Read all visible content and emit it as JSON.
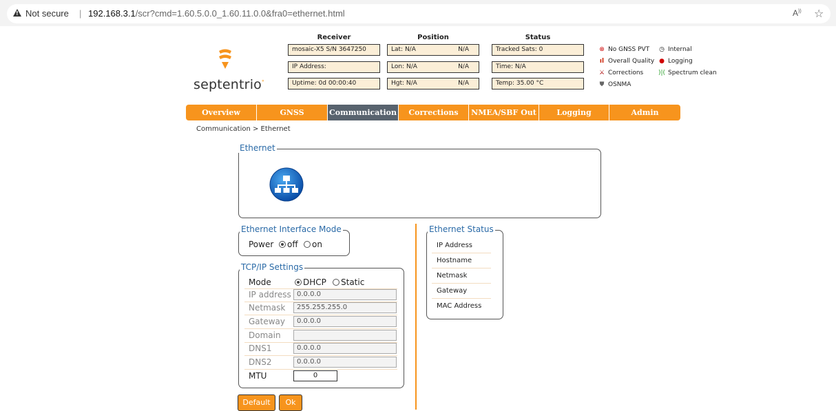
{
  "browser": {
    "security_label": "Not secure",
    "url_host": "192.168.3.1",
    "url_path": "/scr?cmd=1.60.5.0.0_1.60.11.0.0&fra0=ethernet.html",
    "read_aloud": "A",
    "read_aloud_sup": "))"
  },
  "logo": {
    "text": "septentrio",
    "mark": "°"
  },
  "header": {
    "receiver_title": "Receiver",
    "position_title": "Position",
    "status_title": "Status",
    "receiver": [
      "mosaic-X5 S/N 3647250",
      "IP Address:",
      "Uptime: 0d 00:00:40"
    ],
    "position": [
      {
        "label": "Lat: N/A",
        "value": "N/A"
      },
      {
        "label": "Lon: N/A",
        "value": "N/A"
      },
      {
        "label": "Hgt: N/A",
        "value": "N/A"
      }
    ],
    "status": [
      "Tracked Sats: 0",
      "Time: N/A",
      "Temp: 35.00 °C"
    ]
  },
  "legend": {
    "no_pvt": "No GNSS PVT",
    "internal": "Internal",
    "overall_quality": "Overall Quality",
    "logging": "Logging",
    "corrections": "Corrections",
    "spectrum": "Spectrum clean",
    "osnma": "OSNMA",
    "icons": {
      "no_pvt": "x-circle-icon",
      "internal": "clock-icon",
      "overall_quality": "signal-bars-icon",
      "logging": "red-dot-icon",
      "corrections": "antenna-icon",
      "spectrum": "spectrum-icon",
      "osnma": "shield-icon"
    },
    "colors": {
      "logging": "#d00000",
      "spectrum": "#2aa02a",
      "quality": "#cc2200"
    }
  },
  "nav": {
    "tabs": [
      "Overview",
      "GNSS",
      "Communication",
      "Corrections",
      "NMEA/SBF Out",
      "Logging",
      "Admin"
    ],
    "active": "Communication",
    "colors": {
      "bar": "#f7941d",
      "active": "#58636e"
    }
  },
  "breadcrumb": "Communication > Ethernet",
  "ethernet": {
    "legend": "Ethernet",
    "icon": "network-icon"
  },
  "interface_mode": {
    "legend": "Ethernet Interface Mode",
    "power_label": "Power",
    "off_label": "off",
    "on_label": "on",
    "selected": "off"
  },
  "tcpip": {
    "legend": "TCP/IP Settings",
    "mode_label": "Mode",
    "dhcp_label": "DHCP",
    "static_label": "Static",
    "selected": "DHCP",
    "fields": [
      {
        "label": "IP address",
        "value": "0.0.0.0"
      },
      {
        "label": "Netmask",
        "value": "255.255.255.0"
      },
      {
        "label": "Gateway",
        "value": "0.0.0.0"
      },
      {
        "label": "Domain",
        "value": ""
      },
      {
        "label": "DNS1",
        "value": "0.0.0.0"
      },
      {
        "label": "DNS2",
        "value": "0.0.0.0"
      }
    ],
    "mtu_label": "MTU",
    "mtu_value": "0"
  },
  "buttons": {
    "default": "Default",
    "ok": "Ok"
  },
  "status": {
    "legend": "Ethernet Status",
    "rows": [
      "IP Address",
      "Hostname",
      "Netmask",
      "Gateway",
      "MAC Address"
    ]
  }
}
